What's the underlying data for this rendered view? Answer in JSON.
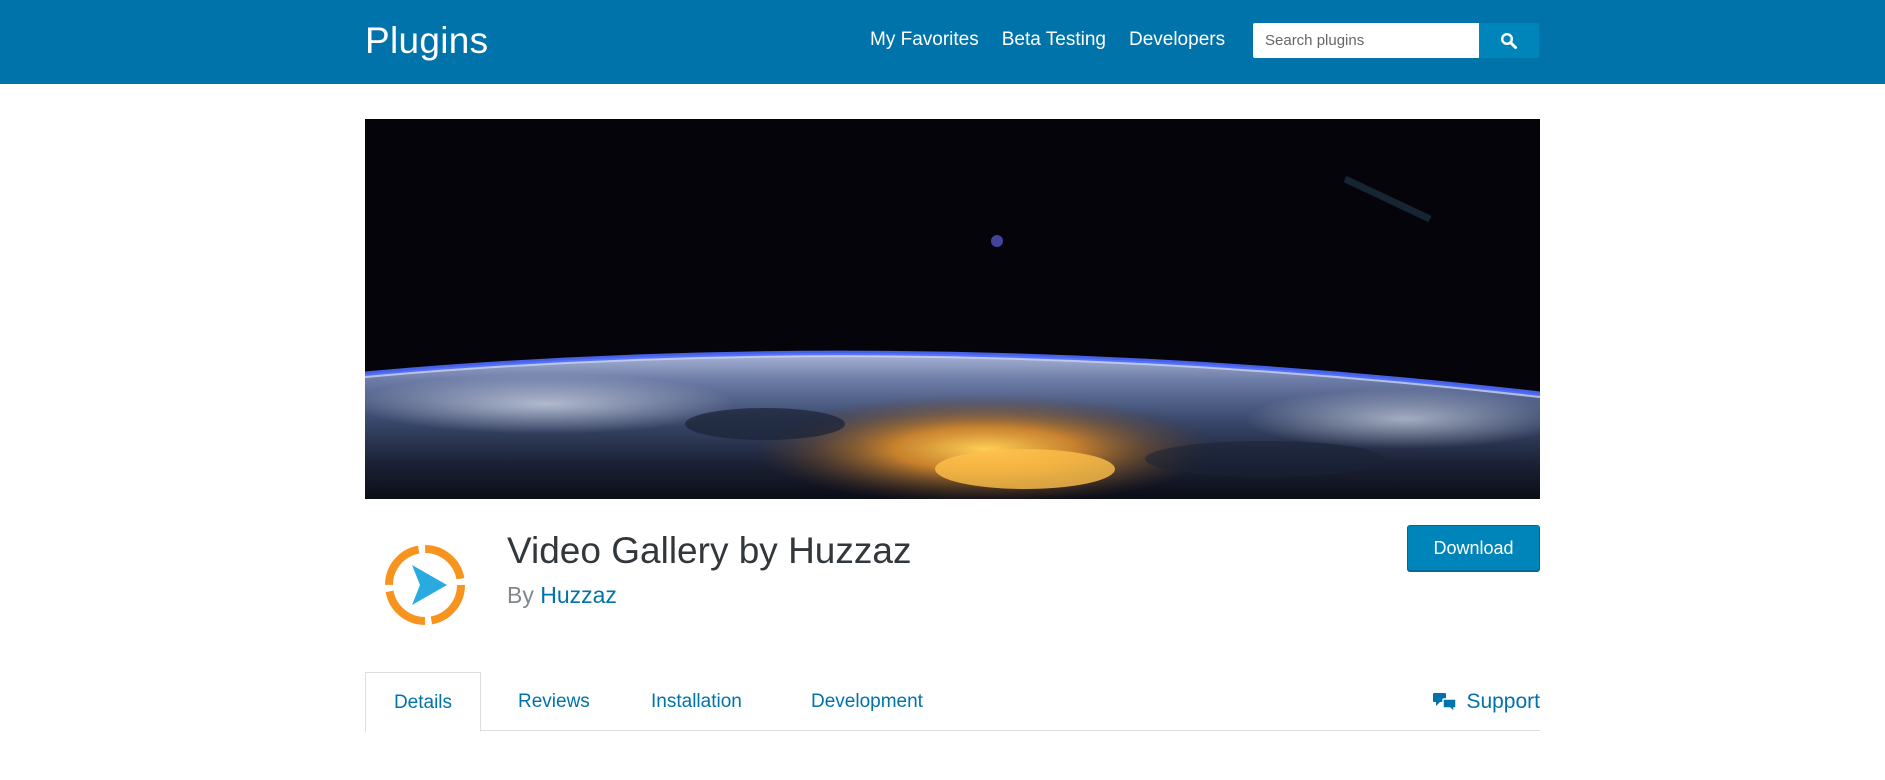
{
  "header": {
    "site_title": "Plugins",
    "nav": [
      {
        "label": "My Favorites"
      },
      {
        "label": "Beta Testing"
      },
      {
        "label": "Developers"
      }
    ],
    "search": {
      "placeholder": "Search plugins",
      "value": "",
      "icon": "search-icon"
    }
  },
  "plugin": {
    "title": "Video Gallery by Huzzaz",
    "by_prefix": "By",
    "author": "Huzzaz",
    "download_label": "Download",
    "icon": "play-circle-icon"
  },
  "tabs": [
    {
      "label": "Details",
      "active": true
    },
    {
      "label": "Reviews",
      "active": false
    },
    {
      "label": "Installation",
      "active": false
    },
    {
      "label": "Development",
      "active": false
    }
  ],
  "support": {
    "label": "Support",
    "icon": "speech-bubbles-icon"
  },
  "colors": {
    "header_bg": "#0073aa",
    "link": "#0073aa",
    "button": "#0085ba",
    "icon_orange": "#f7941d",
    "icon_blue": "#29abe2"
  }
}
